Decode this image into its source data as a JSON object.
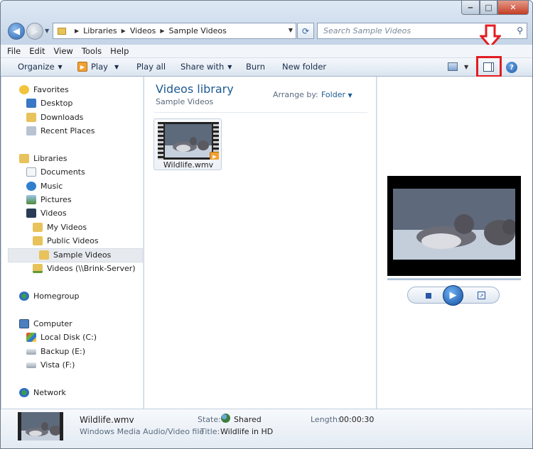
{
  "window": {
    "min": "‒",
    "max": "□",
    "close": "✕"
  },
  "address": {
    "crumbs": [
      "Libraries",
      "Videos",
      "Sample Videos"
    ]
  },
  "search": {
    "placeholder": "Search Sample Videos"
  },
  "menu": [
    "File",
    "Edit",
    "View",
    "Tools",
    "Help"
  ],
  "commands": {
    "organize": "Organize",
    "play": "Play",
    "play_all": "Play all",
    "share_with": "Share with",
    "burn": "Burn",
    "new_folder": "New folder"
  },
  "nav": {
    "favorites": "Favorites",
    "desktop": "Desktop",
    "downloads": "Downloads",
    "recent": "Recent Places",
    "libraries": "Libraries",
    "documents": "Documents",
    "music": "Music",
    "pictures": "Pictures",
    "videos": "Videos",
    "my_videos": "My Videos",
    "public_videos": "Public Videos",
    "sample_videos": "Sample Videos",
    "brink": "Videos (\\\\Brink-Server)",
    "homegroup": "Homegroup",
    "computer": "Computer",
    "local_disk": "Local Disk (C:)",
    "backup": "Backup (E:)",
    "vista": "Vista (F:)",
    "network": "Network"
  },
  "content": {
    "title": "Videos library",
    "subtitle": "Sample Videos",
    "arrange_label": "Arrange by:",
    "arrange_value": "Folder",
    "file_name": "Wildlife.wmv"
  },
  "status": {
    "name": "Wildlife.wmv",
    "type": "Windows Media Audio/Video file",
    "state_label": "State:",
    "state_value": "Shared",
    "title_label": "Title:",
    "title_value": "Wildlife in HD",
    "length_label": "Length:",
    "length_value": "00:00:30"
  },
  "colors": {
    "highlight": "#e21c22",
    "accent": "#1e5b91"
  }
}
